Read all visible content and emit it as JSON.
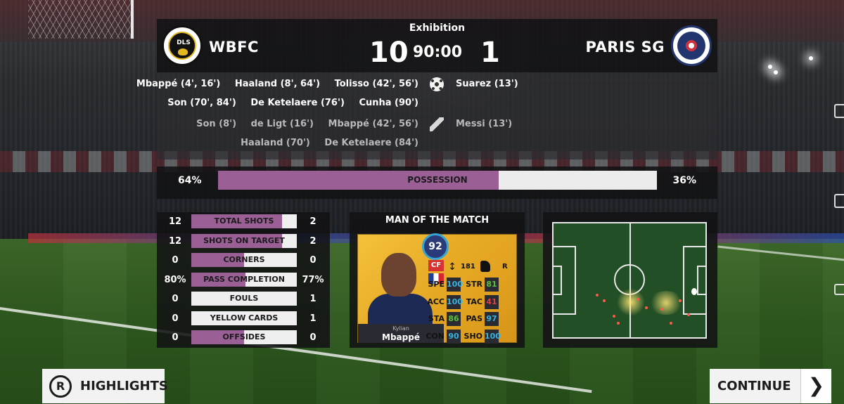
{
  "match": {
    "competition": "Exhibition",
    "clock": "90:00",
    "home": {
      "name": "WBFC",
      "score": "10",
      "logo_text": "DLS"
    },
    "away": {
      "name": "PARIS SG",
      "score": "1"
    }
  },
  "goals": {
    "home_lines": [
      [
        "Mbappé (4', 16')",
        "Haaland (8', 64')",
        "Tolisso (42', 56')"
      ],
      [
        "Son (70', 84')",
        "De Ketelaere (76')",
        "Cunha (90')"
      ]
    ],
    "away_lines": [
      [
        "Suarez (13')"
      ]
    ],
    "icon": "soccer-ball-icon"
  },
  "assists": {
    "home_lines": [
      [
        "Son (8')",
        "de Ligt (16')",
        "Mbappé (42', 56')"
      ],
      [
        "Haaland (70')",
        "De Ketelaere (84')"
      ]
    ],
    "away_lines": [
      [
        "Messi (13')"
      ]
    ],
    "icon": "boot-icon"
  },
  "possession": {
    "label": "POSSESSION",
    "home": "64%",
    "away": "36%",
    "home_fraction": 0.64
  },
  "stats": [
    {
      "label": "TOTAL SHOTS",
      "home": "12",
      "away": "2",
      "home_fraction": 0.857
    },
    {
      "label": "SHOTS ON TARGET",
      "home": "12",
      "away": "2",
      "home_fraction": 0.857
    },
    {
      "label": "CORNERS",
      "home": "0",
      "away": "0",
      "home_fraction": 0.5
    },
    {
      "label": "PASS COMPLETION",
      "home": "80%",
      "away": "77%",
      "home_fraction": 0.51
    },
    {
      "label": "FOULS",
      "home": "0",
      "away": "1",
      "home_fraction": 0.0
    },
    {
      "label": "YELLOW CARDS",
      "home": "0",
      "away": "1",
      "home_fraction": 0.0
    },
    {
      "label": "OFFSIDES",
      "home": "0",
      "away": "0",
      "home_fraction": 0.5
    }
  ],
  "man_of_the_match": {
    "title": "MAN OF THE MATCH",
    "first_name": "Kylian",
    "last_name": "Mbappé",
    "rating": "92",
    "position": "CF",
    "height": "181",
    "foot": "R",
    "attributes": [
      {
        "label": "SPE",
        "value": "100",
        "color": "#35b3e0"
      },
      {
        "label": "STR",
        "value": "81",
        "color": "#5ec13b"
      },
      {
        "label": "ACC",
        "value": "100",
        "color": "#35b3e0"
      },
      {
        "label": "TAC",
        "value": "41",
        "color": "#e04040"
      },
      {
        "label": "STA",
        "value": "86",
        "color": "#5ec13b"
      },
      {
        "label": "PAS",
        "value": "97",
        "color": "#35b3e0"
      },
      {
        "label": "CON",
        "value": "90",
        "color": "#35b3e0"
      },
      {
        "label": "SHO",
        "value": "100",
        "color": "#35b3e0"
      }
    ]
  },
  "buttons": {
    "highlights": "HIGHLIGHTS",
    "continue": "CONTINUE"
  },
  "colors": {
    "home_bar": "#9a6096",
    "panel": "#121214",
    "button": "#f2f2f2"
  }
}
